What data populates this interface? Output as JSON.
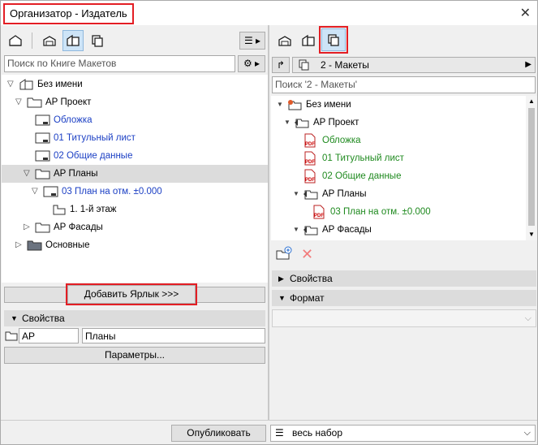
{
  "window": {
    "title": "Организатор - Издатель"
  },
  "left": {
    "search_placeholder": "Поиск по Книге Макетов",
    "tree": [
      {
        "label": "Без имени",
        "color": "black"
      },
      {
        "label": "АР Проект",
        "color": "black"
      },
      {
        "label": "Обложка",
        "color": "blue"
      },
      {
        "label": "01 Титульный лист",
        "color": "blue"
      },
      {
        "label": "02 Общие данные",
        "color": "blue"
      },
      {
        "label": "АР Планы",
        "color": "black"
      },
      {
        "label": "03 План на отм. ±0.000",
        "color": "blue"
      },
      {
        "label": "1. 1-й этаж",
        "color": "black"
      },
      {
        "label": "АР Фасады",
        "color": "black"
      },
      {
        "label": "Основные",
        "color": "black"
      }
    ],
    "add_shortcut_button": "Добавить Ярлык >>>",
    "properties_header": "Свойства",
    "prop_id_value": "АР",
    "prop_name_value": "Планы",
    "params_button": "Параметры..."
  },
  "right": {
    "set_combo_value": "2 - Макеты",
    "search_placeholder": "Поиск '2 - Макеты'",
    "tree": [
      {
        "label": "Без имени",
        "color": "black"
      },
      {
        "label": "АР Проект",
        "color": "black"
      },
      {
        "label": "Обложка",
        "color": "green"
      },
      {
        "label": "01 Титульный лист",
        "color": "green"
      },
      {
        "label": "02 Общие данные",
        "color": "green"
      },
      {
        "label": "АР Планы",
        "color": "black"
      },
      {
        "label": "03 План на отм. ±0.000",
        "color": "green"
      },
      {
        "label": "АР Фасады",
        "color": "black"
      }
    ],
    "properties_header": "Свойства",
    "format_header": "Формат"
  },
  "bottom": {
    "publish_button": "Опубликовать",
    "set_select_value": "весь набор"
  },
  "icons": {
    "close": "close-icon",
    "pdf": "pdf-icon"
  }
}
